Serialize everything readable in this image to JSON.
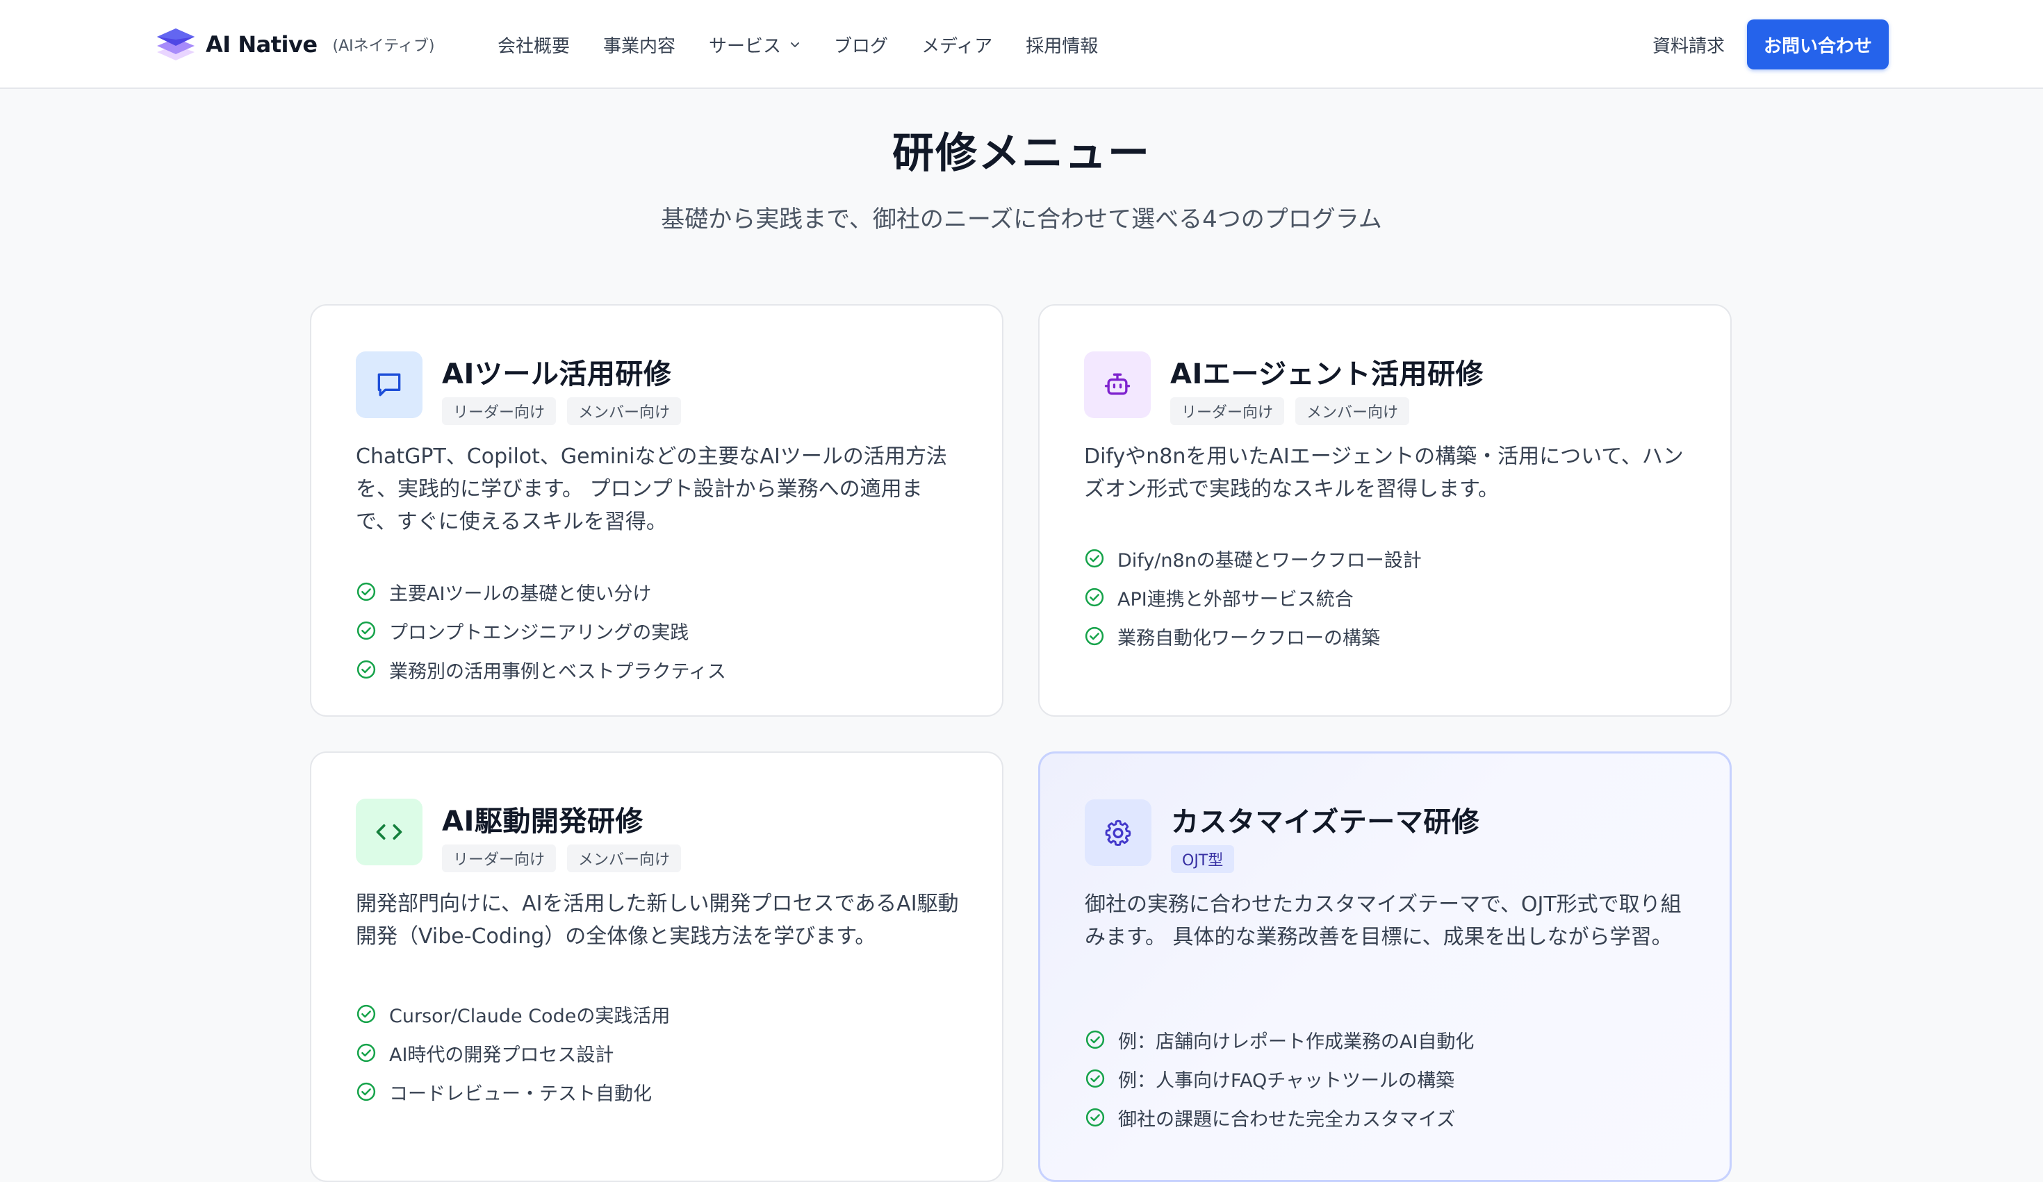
{
  "header": {
    "brand_name": "AI Native",
    "brand_sub": "(AIネイティブ)",
    "nav": [
      {
        "label": "会社概要"
      },
      {
        "label": "事業内容"
      },
      {
        "label": "サービス"
      },
      {
        "label": "ブログ"
      },
      {
        "label": "メディア"
      },
      {
        "label": "採用情報"
      }
    ],
    "doc_request": "資料請求",
    "contact": "お問い合わせ",
    "accent_color": "#2563eb"
  },
  "hero": {
    "title": "研修メニュー",
    "subtitle": "基礎から実践まで、御社のニーズに合わせて選べる4つのプログラム"
  },
  "cards": [
    {
      "icon": "chat-bubble-icon",
      "title": "AIツール活用研修",
      "tags": [
        "リーダー向け",
        "メンバー向け"
      ],
      "description": "ChatGPT、Copilot、Geminiなどの主要なAIツールの活用方法を、実践的に学びます。 プロンプト設計から業務への適用まで、すぐに使えるスキルを習得。",
      "features": [
        "主要AIツールの基礎と使い分け",
        "プロンプトエンジニアリングの実践",
        "業務別の活用事例とベストプラクティス"
      ]
    },
    {
      "icon": "robot-icon",
      "title": "AIエージェント活用研修",
      "tags": [
        "リーダー向け",
        "メンバー向け"
      ],
      "description": "Difyやn8nを用いたAIエージェントの構築・活用について、ハンズオン形式で実践的なスキルを習得します。",
      "features": [
        "Dify/n8nの基礎とワークフロー設計",
        "API連携と外部サービス統合",
        "業務自動化ワークフローの構築"
      ]
    },
    {
      "icon": "code-icon",
      "title": "AI駆動開発研修",
      "tags": [
        "リーダー向け",
        "メンバー向け"
      ],
      "description": "開発部門向けに、AIを活用した新しい開発プロセスであるAI駆動開発（Vibe-Coding）の全体像と実践方法を学びます。",
      "features": [
        "Cursor/Claude Codeの実践活用",
        "AI時代の開発プロセス設計",
        "コードレビュー・テスト自動化"
      ]
    },
    {
      "icon": "gear-icon",
      "title": "カスタマイズテーマ研修",
      "tags": [
        "OJT型"
      ],
      "description": "御社の実務に合わせたカスタマイズテーマで、OJT形式で取り組みます。 具体的な業務改善を目標に、成果を出しながら学習。",
      "features": [
        "例：店舗向けレポート作成業務のAI自動化",
        "例：人事向けFAQチャットツールの構築",
        "御社の課題に合わせた完全カスタマイズ"
      ]
    }
  ]
}
